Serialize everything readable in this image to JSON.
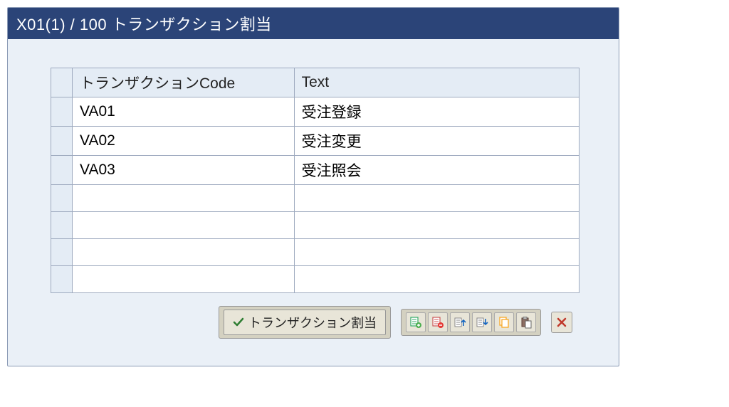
{
  "title": "X01(1) / 100 トランザクション割当",
  "table": {
    "headers": {
      "code": "トランザクションCode",
      "text": "Text"
    },
    "rows": [
      {
        "code": "VA01",
        "text": "受注登録"
      },
      {
        "code": "VA02",
        "text": "受注変更"
      },
      {
        "code": "VA03",
        "text": "受注照会"
      },
      {
        "code": "",
        "text": ""
      },
      {
        "code": "",
        "text": ""
      },
      {
        "code": "",
        "text": ""
      },
      {
        "code": "",
        "text": ""
      }
    ]
  },
  "toolbar": {
    "assign_label": "トランザクション割当"
  }
}
